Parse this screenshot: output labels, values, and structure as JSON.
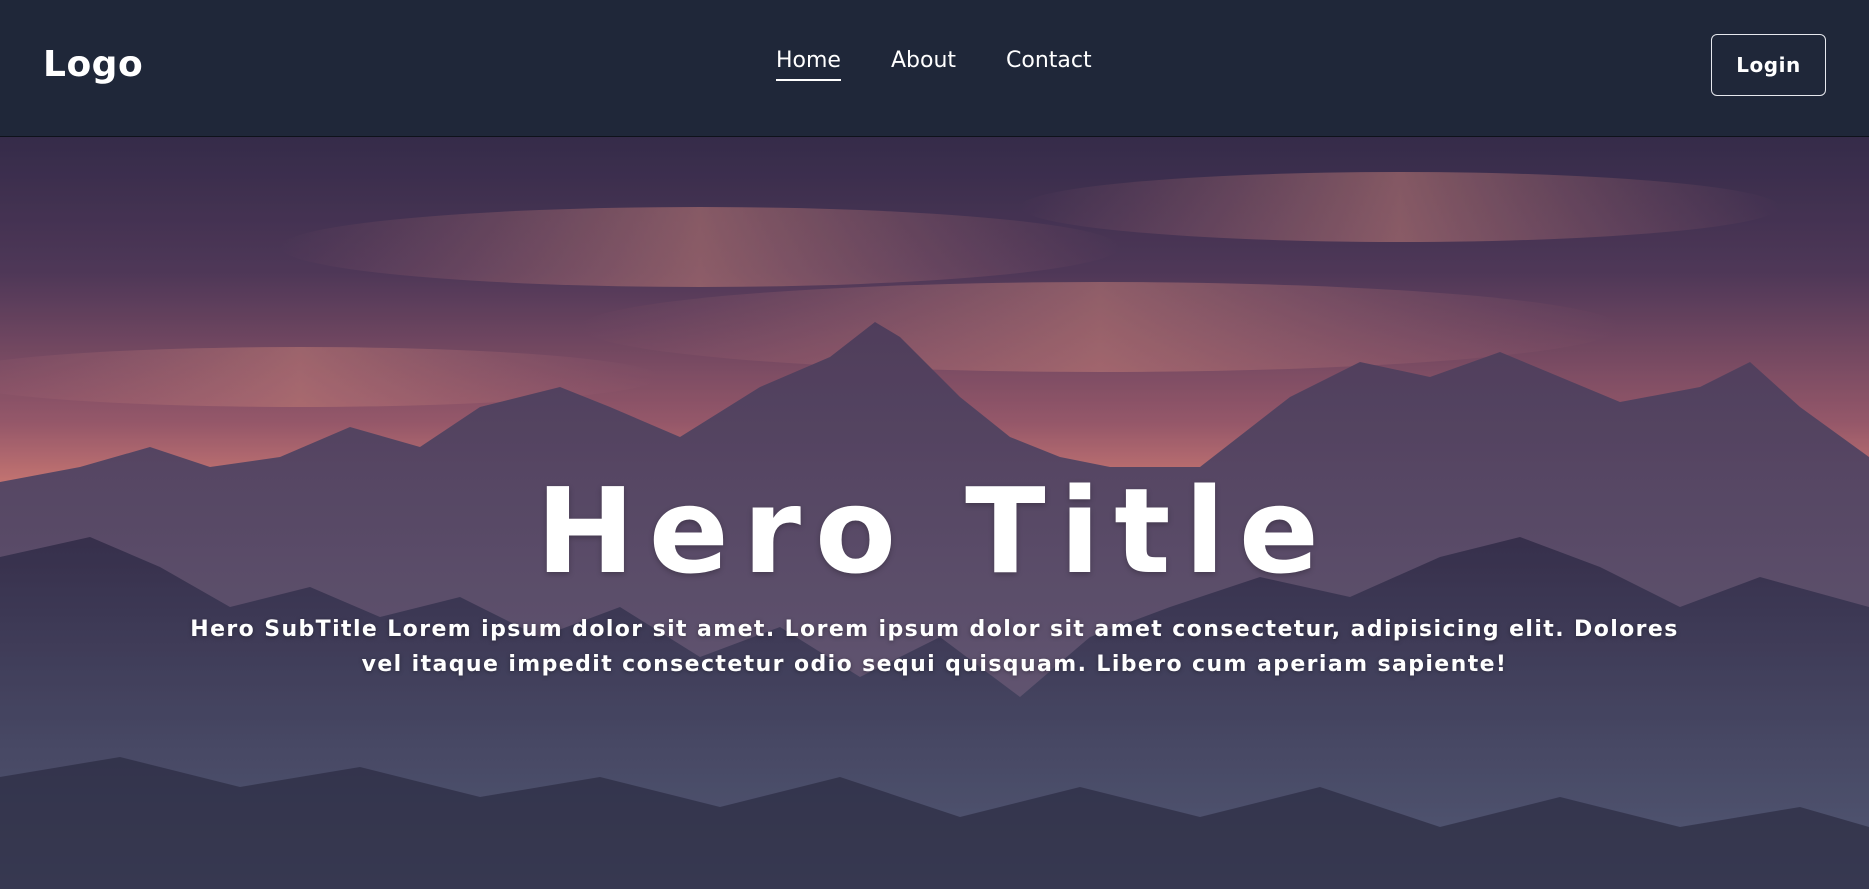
{
  "navbar": {
    "logo": "Logo",
    "links": [
      {
        "label": "Home",
        "active": true
      },
      {
        "label": "About",
        "active": false
      },
      {
        "label": "Contact",
        "active": false
      }
    ],
    "login_label": "Login"
  },
  "hero": {
    "title": "Hero Title",
    "subtitle": "Hero SubTitle Lorem ipsum dolor sit amet. Lorem ipsum dolor sit amet consectetur, adipisicing elit. Dolores vel itaque impedit consectetur odio sequi quisquam. Libero cum aperiam sapiente!"
  },
  "colors": {
    "navbar_bg": "#1f2739",
    "text": "#ffffff",
    "sky_glow": "#e8877e"
  }
}
